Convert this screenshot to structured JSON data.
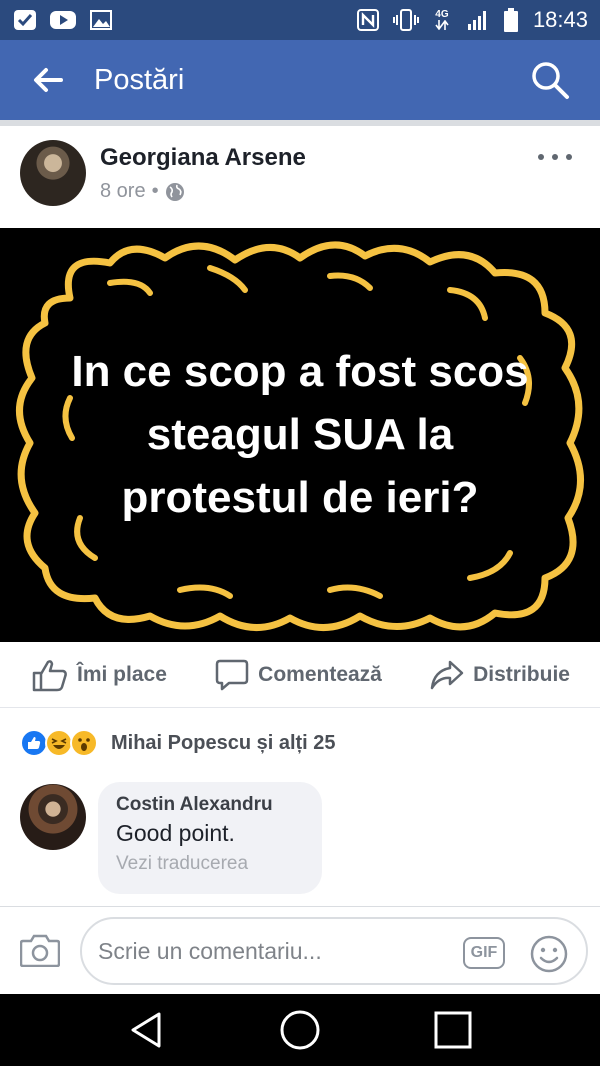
{
  "status_bar": {
    "time": "18:43",
    "icons": [
      "checkbox-icon",
      "youtube-icon",
      "gallery-icon",
      "nfc-icon",
      "vibrate-icon",
      "4g-icon",
      "signal-icon",
      "battery-icon"
    ],
    "network_label": "4G"
  },
  "app_bar": {
    "title": "Postări",
    "back_icon": "arrow-left-icon",
    "search_icon": "search-icon",
    "background": "#4267b2"
  },
  "post": {
    "author": "Georgiana Arsene",
    "time": "8 ore",
    "separator": "•",
    "audience_icon": "globe-icon",
    "image": {
      "lines": [
        "In ce scop a fost scos",
        "steagul SUA la",
        "protestul de ieri?"
      ],
      "border_color": "#f5c242"
    }
  },
  "actions": {
    "like": "Îmi place",
    "comment": "Comentează",
    "share": "Distribuie"
  },
  "reactions": {
    "icons": [
      "like-icon",
      "haha-icon",
      "wow-icon"
    ],
    "summary": "Mihai Popescu și alți 25"
  },
  "comment": {
    "author": "Costin Alexandru",
    "text": "Good point.",
    "translate": "Vezi traducerea"
  },
  "composer": {
    "placeholder": "Scrie un comentariu...",
    "gif_label": "GIF"
  },
  "nav": {
    "back": "back-triangle-icon",
    "home": "home-circle-icon",
    "recents": "recents-square-icon"
  }
}
